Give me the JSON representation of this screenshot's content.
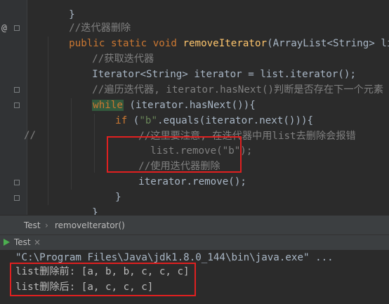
{
  "editor": {
    "lines": [
      {
        "text": "}",
        "cls": ""
      },
      {
        "text": "//迭代器删除",
        "cls": "cm"
      },
      {
        "kw1": "public static void ",
        "fn": "removeIterator",
        "rest": "(ArrayList<String> list){"
      },
      {
        "text": "//获取迭代器",
        "cls": "cm"
      },
      {
        "text": "Iterator<String> iterator = list.iterator();",
        "cls": ""
      },
      {
        "text": "//遍历迭代器, iterator.hasNext()判断是否存在下一个元素",
        "cls": "cm"
      },
      {
        "kw": "while",
        "rest": " (iterator.hasNext()){"
      },
      {
        "kw": "if",
        "pre": " (",
        "str": "\"b\"",
        "rest": ".equals(iterator.next())){"
      },
      {
        "text": "//这里要注意, 在迭代器中用list去删除会报错",
        "cls": "cm"
      },
      {
        "text": "list.remove(\"b\");",
        "cls": "cm"
      },
      {
        "text": "//使用迭代器删除",
        "cls": "cm"
      },
      {
        "text": "iterator.remove();",
        "cls": ""
      },
      {
        "text": "}",
        "cls": ""
      },
      {
        "text": "}",
        "cls": ""
      },
      {
        "text": "}",
        "cls": ""
      }
    ],
    "gutter_marker": "@",
    "comment_prefix": "//"
  },
  "breadcrumb": {
    "class_name": "Test",
    "separator": "›",
    "method_name": "removeIterator()"
  },
  "run_tab": {
    "label": "Test",
    "close": "×"
  },
  "console": {
    "command": "\"C:\\Program Files\\Java\\jdk1.8.0_144\\bin\\java.exe\" ...",
    "output": [
      "list删除前: [a, b, b, c, c, c]",
      "list删除后: [a, c, c, c]"
    ]
  },
  "colors": {
    "background": "#2B2B2B",
    "keyword": "#CC7832",
    "function": "#FFC66D",
    "comment": "#808080",
    "string": "#6A8759",
    "highlight_box": "#E02020"
  }
}
